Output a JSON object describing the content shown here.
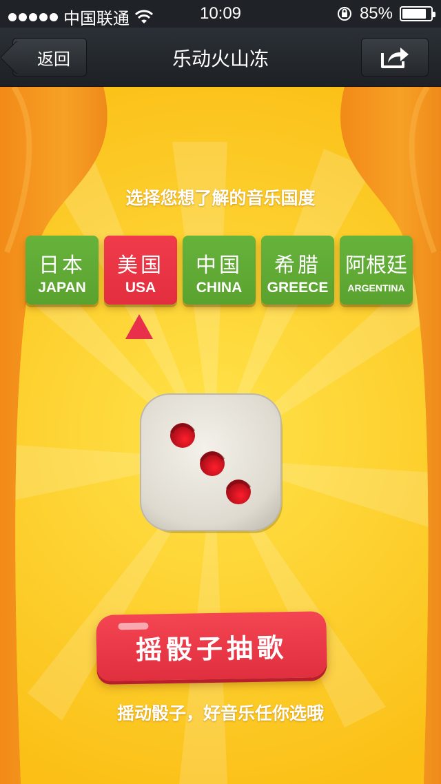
{
  "status_bar": {
    "carrier": "中国联通",
    "time": "10:09",
    "battery_percent_text": "85%",
    "battery_level": 0.85
  },
  "nav": {
    "back_label": "返回",
    "title": "乐动火山冻"
  },
  "main": {
    "prompt": "选择您想了解的音乐国度",
    "countries": [
      {
        "cn": "日本",
        "en": "JAPAN",
        "selected": false
      },
      {
        "cn": "美国",
        "en": "USA",
        "selected": true
      },
      {
        "cn": "中国",
        "en": "CHINA",
        "selected": false
      },
      {
        "cn": "希腊",
        "en": "GREECE",
        "selected": false
      },
      {
        "cn": "阿根廷",
        "en": "ARGENTINA",
        "selected": false
      }
    ],
    "dice_face": 3,
    "shake_button_label": "摇骰子抽歌",
    "tagline": "摇动骰子，好音乐任你选哦"
  },
  "colors": {
    "curtain_orange": "#f08a1c",
    "stage_yellow": "#fcc61a",
    "country_green": "#5ea934",
    "country_selected_red": "#e8344a",
    "button_red": "#ea3a48"
  }
}
